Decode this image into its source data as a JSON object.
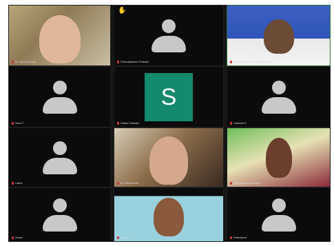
{
  "tiles": [
    {
      "name": "Dr. Santhi Kumar",
      "type": "video",
      "style": "a"
    },
    {
      "name": "Dhanalakshmi Prakash",
      "type": "avatar",
      "hand_raised": true
    },
    {
      "name": "Gunasekar ‑ Karthikeyan Media",
      "type": "video",
      "style": "b",
      "active": true
    },
    {
      "name": "Sam P",
      "type": "avatar"
    },
    {
      "name": "Sakthi Prakash",
      "type": "letter",
      "letter": "S"
    },
    {
      "name": "Lakshmi S",
      "type": "avatar"
    },
    {
      "name": "Latha",
      "type": "avatar"
    },
    {
      "name": "Dr. Saraswathi",
      "type": "video",
      "style": "c"
    },
    {
      "name": "Jayalakshmi Arunagiri",
      "type": "video",
      "style": "d"
    },
    {
      "name": "Guest",
      "type": "avatar"
    },
    {
      "name": "Student",
      "type": "video",
      "style": "e"
    },
    {
      "name": "Participant",
      "type": "avatar"
    }
  ],
  "colors": {
    "grid_bg": "#161616",
    "tile_bg": "#0b0b0b",
    "avatar_gray": "#c8c8c8",
    "letter_avatar_bg": "#138a6d",
    "muted_mic": "#c73a3a"
  }
}
